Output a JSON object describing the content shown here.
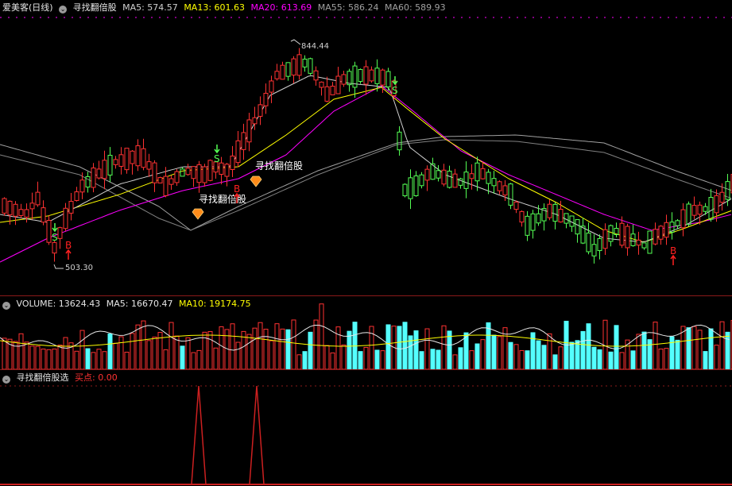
{
  "price_panel": {
    "stock_name": "爱美客(日线)",
    "indicator_name": "寻找翻倍股",
    "ma5": "MA5: 574.57",
    "ma13": "MA13: 601.63",
    "ma20": "MA20: 613.69",
    "ma55": "MA55: 586.24",
    "ma60": "MA60: 589.93",
    "high_label": "844.44",
    "low_label": "503.30",
    "signal_text": "寻找翻倍股",
    "signal_text_2": "寻找翻倍股",
    "buy_mark": "B",
    "sell_mark": "S"
  },
  "volume_panel": {
    "title": "VOLUME: 13624.43",
    "ma5": "MA5: 16670.47",
    "ma10": "MA10: 19174.75"
  },
  "indicator_panel": {
    "title": "寻找翻倍股选",
    "buy_point": "买点: 0.00"
  },
  "colors": {
    "up": "#ff3232",
    "down": "#54ff54",
    "volume_down": "#54ffff",
    "ma5": "#d0d0d0",
    "ma13": "#ffff00",
    "ma20": "#ff00ff",
    "ma55": "#a0a0a0",
    "ma60": "#a0a0a0"
  },
  "icons": [
    "panel-toggle-icon",
    "diamond-signal-icon",
    "buy-arrow-icon",
    "sell-arrow-icon"
  ]
}
